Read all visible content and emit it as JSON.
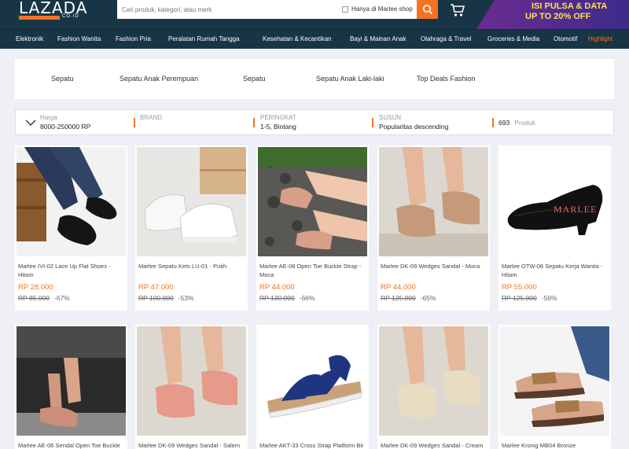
{
  "header": {
    "logo_text": "LAZADA",
    "logo_sub": "CO.ID",
    "search_placeholder": "Cari produk, kategori, atau merk",
    "shop_only_label": "Hanya di Marlee shop",
    "promo_line1": "ISI PULSA & DATA",
    "promo_line2": "UP TO 20% OFF",
    "accent_color": "#f57224"
  },
  "nav": [
    "Elektronik",
    "Fashion Wanita",
    "Fashion Pria",
    "Peralatan Rumah Tangga",
    "Kesehatan & Kecantikan",
    "Bayi & Mainan Anak",
    "Olahraga & Travel",
    "Groceries & Media",
    "Otomotif",
    "Highlight"
  ],
  "categories": [
    "Sepatu",
    "Sepatu Anak Perempuan",
    "Sepatu",
    "Sepatu Anak Laki-laki",
    "Top Deals Fashion"
  ],
  "filter": {
    "price_label": "Harga",
    "price_value": "8000-250000 RP",
    "brand_label": "BRAND",
    "rating_label": "PERINGKAT",
    "rating_value": "1-5, Bintang",
    "sort_label": "SUSUN",
    "sort_value": "Popularitas descending",
    "count": "693",
    "count_unit": "Produk"
  },
  "products": [
    {
      "title": "Marlee IVI-02 Lace Up Flat Shoes - Hitam",
      "price": "RP 28.000",
      "original": "RP 85.000",
      "discount": "-67%"
    },
    {
      "title": "Marlee Sepatu Kets LU-01 - Putih",
      "price": "RP 47.000",
      "original": "RP 100.000",
      "discount": "-53%"
    },
    {
      "title": "Marlee AE-08 Open Toe Buckle Strap - Moca",
      "price": "RP 44.000",
      "original": "RP 130.000",
      "discount": "-66%"
    },
    {
      "title": "Marlee DK-09 Wedges Sandal - Moca",
      "price": "RP 44.000",
      "original": "RP 125.000",
      "discount": "-65%"
    },
    {
      "title": "Marlee OTW-06 Sepatu Kerja Wanita - Hitam",
      "price": "RP 55.000",
      "original": "RP 125.000",
      "discount": "-56%"
    },
    {
      "title": "Marlee AE-06 Sendal Open Toe Buckle",
      "price": "",
      "original": "",
      "discount": ""
    },
    {
      "title": "Marlee DK-09 Wedges Sandal - Salem",
      "price": "",
      "original": "",
      "discount": ""
    },
    {
      "title": "Marlee AKT-33 Cross Strap Platform Bir",
      "price": "",
      "original": "",
      "discount": ""
    },
    {
      "title": "Marlee DK-09 Wedges Sandal - Cream",
      "price": "",
      "original": "",
      "discount": ""
    },
    {
      "title": "Marlee Kronig MB04 Bronze",
      "price": "",
      "original": "",
      "discount": ""
    }
  ],
  "brand_watermark": "MARLEE"
}
